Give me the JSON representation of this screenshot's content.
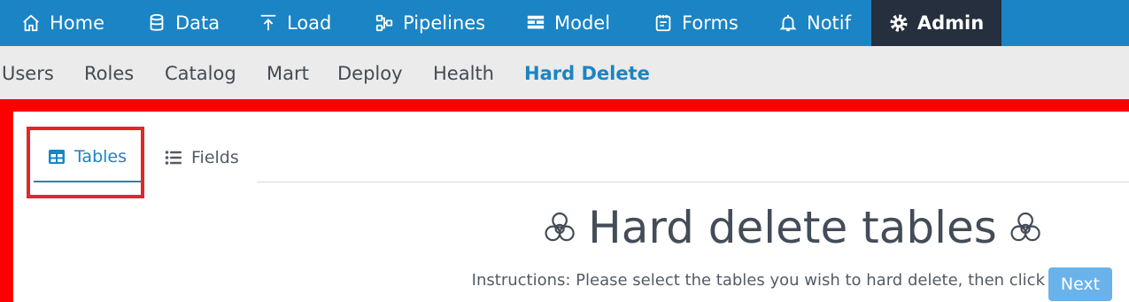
{
  "topnav": {
    "items": [
      {
        "label": "Home",
        "icon": "home-icon"
      },
      {
        "label": "Data",
        "icon": "database-icon"
      },
      {
        "label": "Load",
        "icon": "upload-icon"
      },
      {
        "label": "Pipelines",
        "icon": "pipelines-icon"
      },
      {
        "label": "Model",
        "icon": "model-icon"
      },
      {
        "label": "Forms",
        "icon": "forms-icon"
      },
      {
        "label": "Notif",
        "icon": "bell-icon"
      },
      {
        "label": "Admin",
        "icon": "gear-icon",
        "active": true
      }
    ]
  },
  "subnav": {
    "items": [
      {
        "label": "Users"
      },
      {
        "label": "Roles"
      },
      {
        "label": "Catalog"
      },
      {
        "label": "Mart"
      },
      {
        "label": "Deploy"
      },
      {
        "label": "Health"
      },
      {
        "label": "Hard Delete",
        "active": true
      }
    ]
  },
  "tabs": {
    "items": [
      {
        "label": "Tables",
        "icon": "table-icon",
        "active": true
      },
      {
        "label": "Fields",
        "icon": "list-icon"
      }
    ]
  },
  "main": {
    "title": "Hard delete tables",
    "title_icon": "biohazard-icon",
    "instructions": "Instructions: Please select the tables you wish to hard delete, then click",
    "next_label": "Next"
  },
  "colors": {
    "primary": "#1b84c4",
    "active_nav_bg": "#252f3d",
    "subnav_bg": "#ebebeb",
    "highlight": "#e2262a",
    "outline_red": "#ff0000",
    "next_button": "#6ab2ea"
  }
}
